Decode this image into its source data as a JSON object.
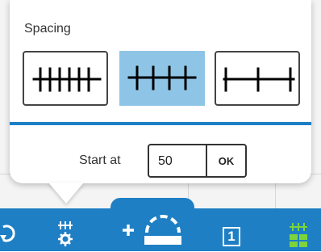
{
  "popover": {
    "title": "Spacing",
    "options": [
      {
        "name": "tight",
        "selected": false
      },
      {
        "name": "medium",
        "selected": true
      },
      {
        "name": "wide",
        "selected": false
      }
    ],
    "start_label": "Start at",
    "start_value": "50",
    "ok_label": "OK"
  },
  "toolbar": {
    "items": [
      {
        "icon": "rotate-icon"
      },
      {
        "icon": "ruler-settings-icon",
        "active": true
      },
      {
        "icon": "add-shape-icon",
        "selected_tab": true
      },
      {
        "icon": "number-one-box-icon",
        "label": "1"
      },
      {
        "icon": "grid-ruler-icon"
      }
    ]
  },
  "colors": {
    "accent": "#1e7fc4",
    "selected_option": "#8ec5e6",
    "toolbar_highlight": "#7cd43c"
  }
}
